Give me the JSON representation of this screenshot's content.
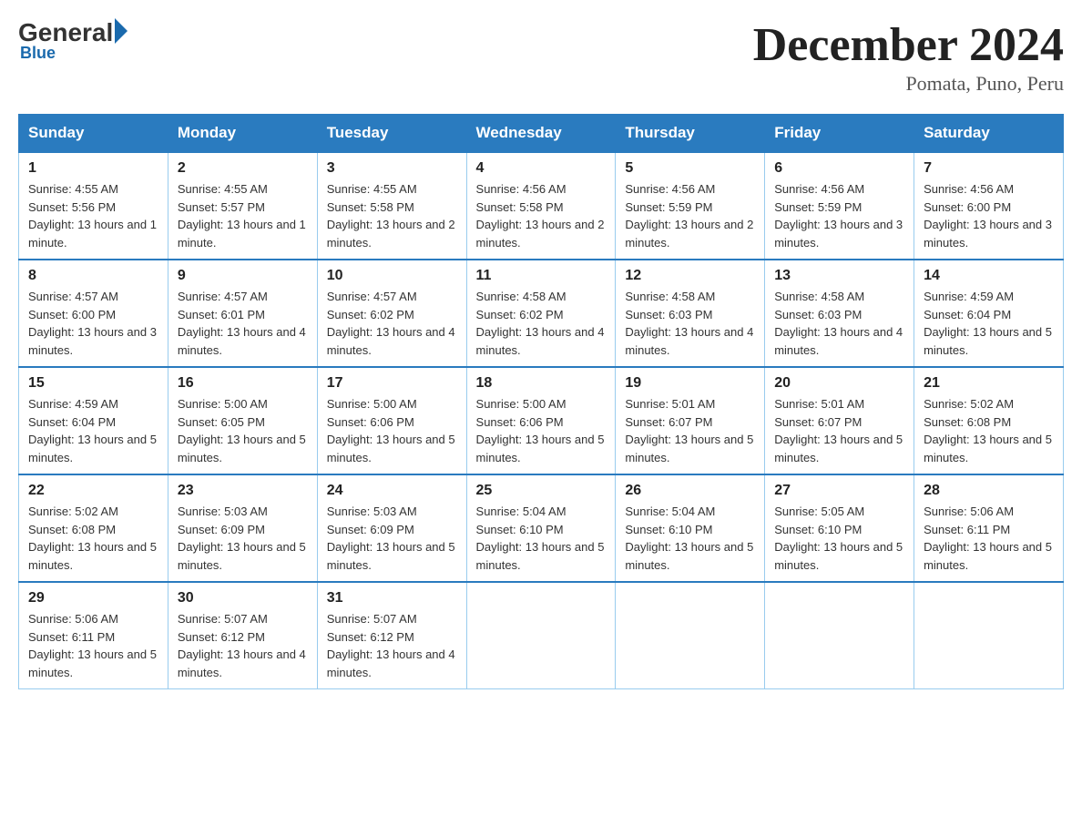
{
  "header": {
    "logo": {
      "general": "General",
      "blue": "Blue"
    },
    "title": "December 2024",
    "subtitle": "Pomata, Puno, Peru"
  },
  "days_of_week": [
    "Sunday",
    "Monday",
    "Tuesday",
    "Wednesday",
    "Thursday",
    "Friday",
    "Saturday"
  ],
  "weeks": [
    [
      {
        "day": "1",
        "sunrise": "4:55 AM",
        "sunset": "5:56 PM",
        "daylight": "13 hours and 1 minute."
      },
      {
        "day": "2",
        "sunrise": "4:55 AM",
        "sunset": "5:57 PM",
        "daylight": "13 hours and 1 minute."
      },
      {
        "day": "3",
        "sunrise": "4:55 AM",
        "sunset": "5:58 PM",
        "daylight": "13 hours and 2 minutes."
      },
      {
        "day": "4",
        "sunrise": "4:56 AM",
        "sunset": "5:58 PM",
        "daylight": "13 hours and 2 minutes."
      },
      {
        "day": "5",
        "sunrise": "4:56 AM",
        "sunset": "5:59 PM",
        "daylight": "13 hours and 2 minutes."
      },
      {
        "day": "6",
        "sunrise": "4:56 AM",
        "sunset": "5:59 PM",
        "daylight": "13 hours and 3 minutes."
      },
      {
        "day": "7",
        "sunrise": "4:56 AM",
        "sunset": "6:00 PM",
        "daylight": "13 hours and 3 minutes."
      }
    ],
    [
      {
        "day": "8",
        "sunrise": "4:57 AM",
        "sunset": "6:00 PM",
        "daylight": "13 hours and 3 minutes."
      },
      {
        "day": "9",
        "sunrise": "4:57 AM",
        "sunset": "6:01 PM",
        "daylight": "13 hours and 4 minutes."
      },
      {
        "day": "10",
        "sunrise": "4:57 AM",
        "sunset": "6:02 PM",
        "daylight": "13 hours and 4 minutes."
      },
      {
        "day": "11",
        "sunrise": "4:58 AM",
        "sunset": "6:02 PM",
        "daylight": "13 hours and 4 minutes."
      },
      {
        "day": "12",
        "sunrise": "4:58 AM",
        "sunset": "6:03 PM",
        "daylight": "13 hours and 4 minutes."
      },
      {
        "day": "13",
        "sunrise": "4:58 AM",
        "sunset": "6:03 PM",
        "daylight": "13 hours and 4 minutes."
      },
      {
        "day": "14",
        "sunrise": "4:59 AM",
        "sunset": "6:04 PM",
        "daylight": "13 hours and 5 minutes."
      }
    ],
    [
      {
        "day": "15",
        "sunrise": "4:59 AM",
        "sunset": "6:04 PM",
        "daylight": "13 hours and 5 minutes."
      },
      {
        "day": "16",
        "sunrise": "5:00 AM",
        "sunset": "6:05 PM",
        "daylight": "13 hours and 5 minutes."
      },
      {
        "day": "17",
        "sunrise": "5:00 AM",
        "sunset": "6:06 PM",
        "daylight": "13 hours and 5 minutes."
      },
      {
        "day": "18",
        "sunrise": "5:00 AM",
        "sunset": "6:06 PM",
        "daylight": "13 hours and 5 minutes."
      },
      {
        "day": "19",
        "sunrise": "5:01 AM",
        "sunset": "6:07 PM",
        "daylight": "13 hours and 5 minutes."
      },
      {
        "day": "20",
        "sunrise": "5:01 AM",
        "sunset": "6:07 PM",
        "daylight": "13 hours and 5 minutes."
      },
      {
        "day": "21",
        "sunrise": "5:02 AM",
        "sunset": "6:08 PM",
        "daylight": "13 hours and 5 minutes."
      }
    ],
    [
      {
        "day": "22",
        "sunrise": "5:02 AM",
        "sunset": "6:08 PM",
        "daylight": "13 hours and 5 minutes."
      },
      {
        "day": "23",
        "sunrise": "5:03 AM",
        "sunset": "6:09 PM",
        "daylight": "13 hours and 5 minutes."
      },
      {
        "day": "24",
        "sunrise": "5:03 AM",
        "sunset": "6:09 PM",
        "daylight": "13 hours and 5 minutes."
      },
      {
        "day": "25",
        "sunrise": "5:04 AM",
        "sunset": "6:10 PM",
        "daylight": "13 hours and 5 minutes."
      },
      {
        "day": "26",
        "sunrise": "5:04 AM",
        "sunset": "6:10 PM",
        "daylight": "13 hours and 5 minutes."
      },
      {
        "day": "27",
        "sunrise": "5:05 AM",
        "sunset": "6:10 PM",
        "daylight": "13 hours and 5 minutes."
      },
      {
        "day": "28",
        "sunrise": "5:06 AM",
        "sunset": "6:11 PM",
        "daylight": "13 hours and 5 minutes."
      }
    ],
    [
      {
        "day": "29",
        "sunrise": "5:06 AM",
        "sunset": "6:11 PM",
        "daylight": "13 hours and 5 minutes."
      },
      {
        "day": "30",
        "sunrise": "5:07 AM",
        "sunset": "6:12 PM",
        "daylight": "13 hours and 4 minutes."
      },
      {
        "day": "31",
        "sunrise": "5:07 AM",
        "sunset": "6:12 PM",
        "daylight": "13 hours and 4 minutes."
      },
      null,
      null,
      null,
      null
    ]
  ]
}
